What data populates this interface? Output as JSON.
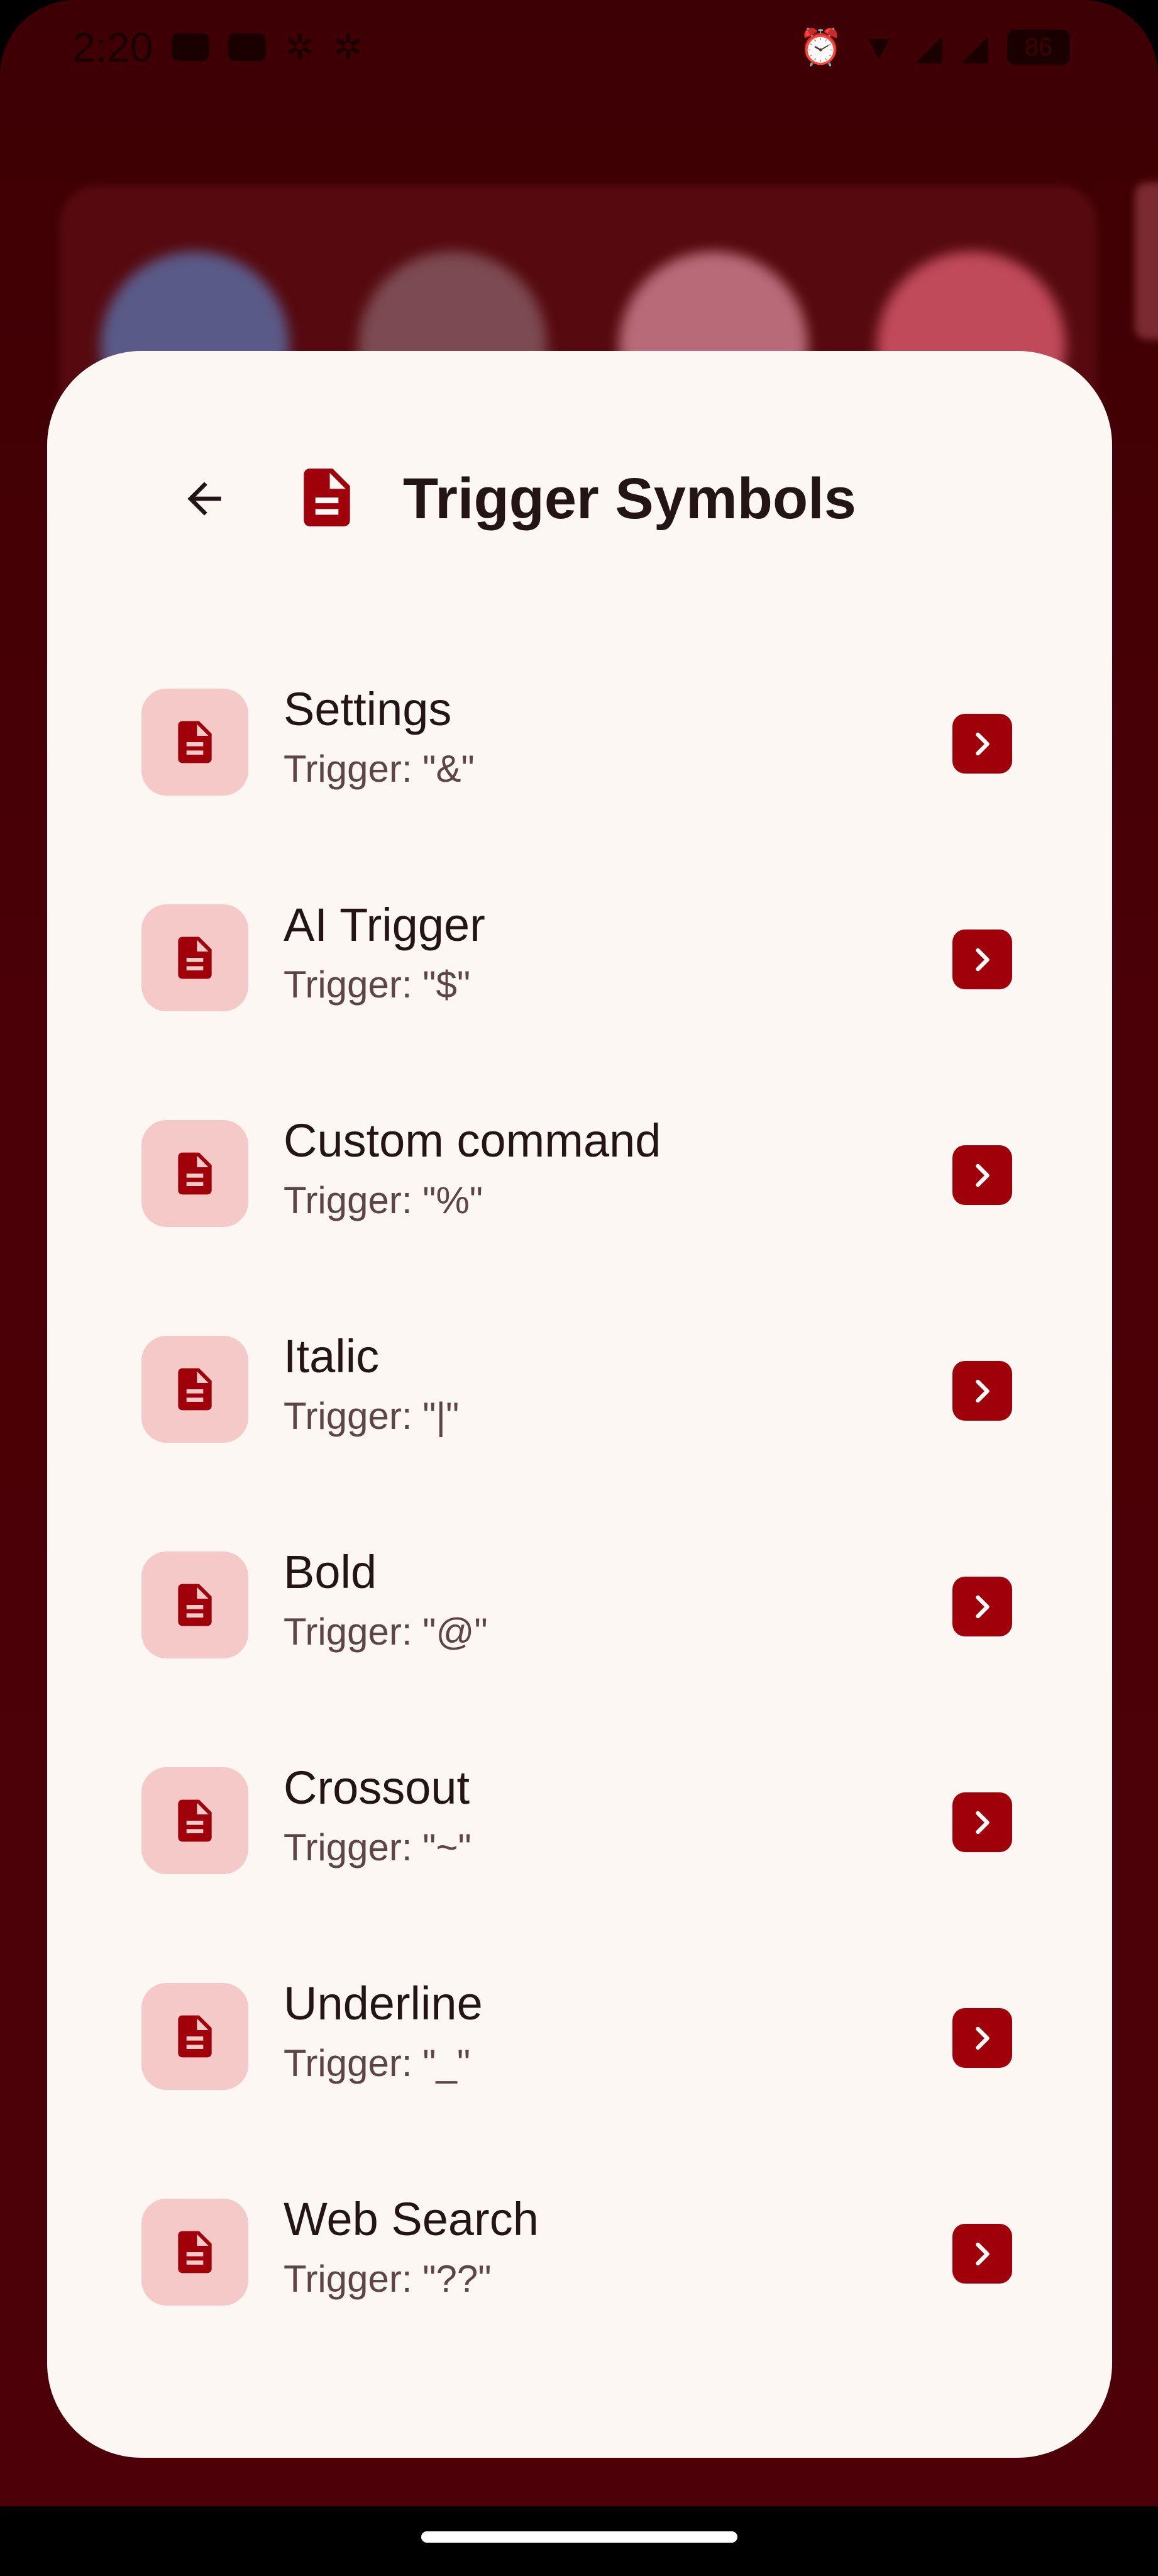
{
  "status_bar": {
    "time": "2:20",
    "left_icons": [
      "youtube-icon",
      "youtube-icon",
      "slack-icon",
      "slack-icon"
    ],
    "right_icons": [
      "alarm-icon",
      "wifi-icon",
      "signal-icon",
      "signal-icon"
    ],
    "battery": "86"
  },
  "header": {
    "back_icon": "arrow-left-icon",
    "doc_icon": "document-icon",
    "title": "Trigger Symbols"
  },
  "items": [
    {
      "title": "Settings",
      "subtitle": "Trigger: \"&\""
    },
    {
      "title": "AI Trigger",
      "subtitle": "Trigger: \"$\""
    },
    {
      "title": "Custom command",
      "subtitle": "Trigger: \"%\""
    },
    {
      "title": "Italic",
      "subtitle": "Trigger: \"|\""
    },
    {
      "title": "Bold",
      "subtitle": "Trigger: \"@\""
    },
    {
      "title": "Crossout",
      "subtitle": "Trigger: \"~\""
    },
    {
      "title": "Underline",
      "subtitle": "Trigger: \"_\""
    },
    {
      "title": "Web Search",
      "subtitle": "Trigger: \"??\""
    }
  ],
  "colors": {
    "accent": "#a00009",
    "icon_bg": "#f4c9c8",
    "sheet_bg": "#fdf7f4",
    "backdrop": "#4a0006"
  }
}
